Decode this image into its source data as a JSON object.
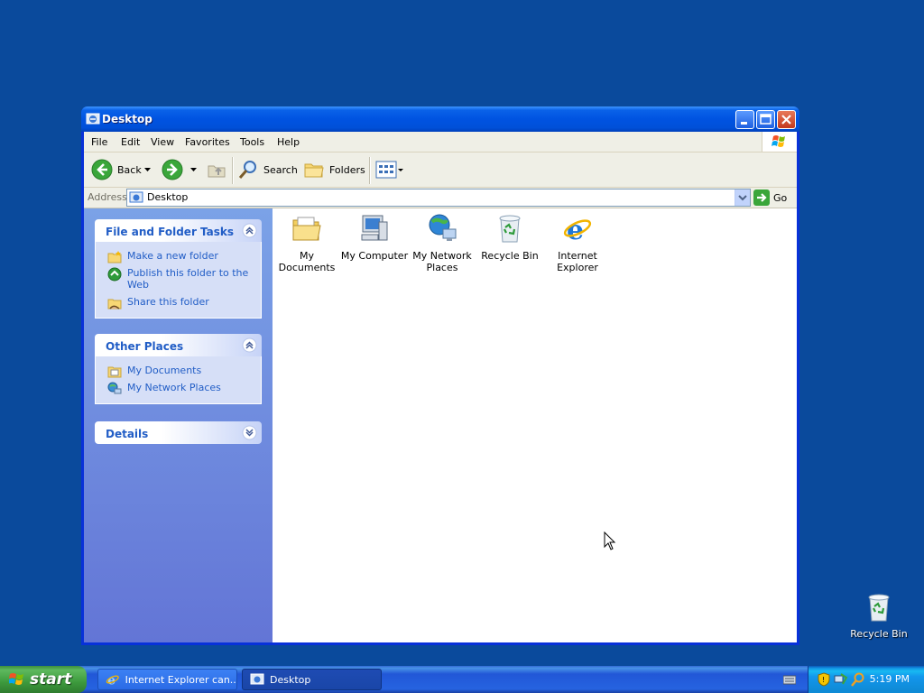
{
  "desktop": {
    "icons": [
      {
        "label": "Recycle Bin",
        "icon": "recycle-bin-icon"
      }
    ]
  },
  "window": {
    "title": "Desktop",
    "menu": [
      "File",
      "Edit",
      "View",
      "Favorites",
      "Tools",
      "Help"
    ],
    "toolbar": {
      "back": "Back",
      "search": "Search",
      "folders": "Folders"
    },
    "address": {
      "label": "Address",
      "value": "Desktop",
      "go": "Go"
    },
    "tasks": {
      "file_folder": {
        "title": "File and Folder Tasks",
        "items": [
          "Make a new folder",
          "Publish this folder to the Web",
          "Share this folder"
        ]
      },
      "other_places": {
        "title": "Other Places",
        "items": [
          "My Documents",
          "My Network Places"
        ]
      },
      "details": {
        "title": "Details"
      }
    },
    "files": [
      {
        "label": "My Documents",
        "icon": "my-documents-icon"
      },
      {
        "label": "My Computer",
        "icon": "my-computer-icon"
      },
      {
        "label": "My Network Places",
        "icon": "network-places-icon"
      },
      {
        "label": "Recycle Bin",
        "icon": "recycle-bin-icon"
      },
      {
        "label": "Internet Explorer",
        "icon": "internet-explorer-icon"
      }
    ]
  },
  "taskbar": {
    "start": "start",
    "tasks": [
      {
        "label": "Internet Explorer can...",
        "icon": "internet-explorer-icon"
      },
      {
        "label": "Desktop",
        "icon": "folder-window-icon"
      }
    ],
    "clock": "5:19 PM"
  },
  "colors": {
    "desktop": "#0a4a9c",
    "title_blue": "#0053e1",
    "link_blue": "#215dc6",
    "start_green": "#3d9a3d"
  }
}
